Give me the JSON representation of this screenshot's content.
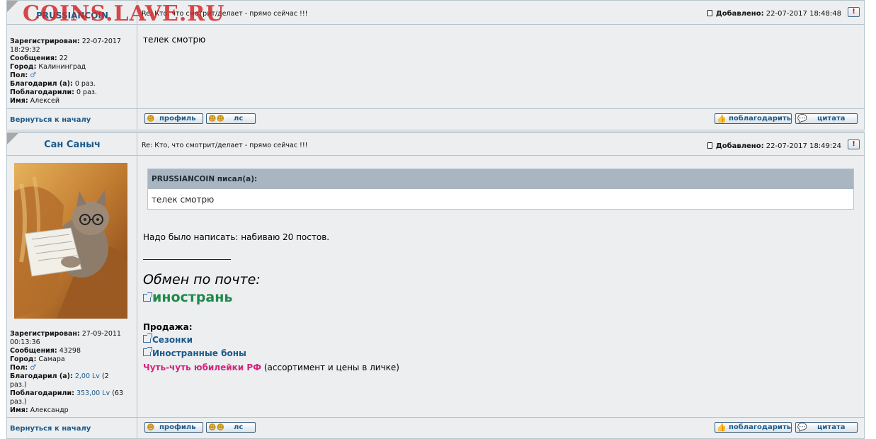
{
  "watermark": "COINS.LAVE.RU",
  "posts": [
    {
      "author": "PRUSSIANCOIN",
      "subject": "Re: Кто, что смотрит/делает - прямо сейчас !!!",
      "added_label": "Добавлено:",
      "added_value": "22-07-2017 18:48:48",
      "report_icon": "!",
      "info": {
        "registered_label": "Зарегистрирован:",
        "registered_value": "22-07-2017",
        "registered_time": "18:29:32",
        "messages_label": "Сообщения:",
        "messages_value": "22",
        "city_label": "Город:",
        "city_value": "Калининград",
        "gender_label": "Пол:",
        "gender_icon": "♂",
        "thanked_label": "Благодарил (а):",
        "thanked_value": "0 раз.",
        "was_thanked_label": "Поблагодарили:",
        "was_thanked_value": "0 раз.",
        "name_label": "Имя:",
        "name_value": "Алексей"
      },
      "body": "телек смотрю"
    },
    {
      "author": "Сан Саныч",
      "subject": "Re: Кто, что смотрит/делает - прямо сейчас !!!",
      "added_label": "Добавлено:",
      "added_value": "22-07-2017 18:49:24",
      "report_icon": "!",
      "info": {
        "registered_label": "Зарегистрирован:",
        "registered_value": "27-09-2011",
        "registered_time": "00:13:36",
        "messages_label": "Сообщения:",
        "messages_value": "43298",
        "city_label": "Город:",
        "city_value": "Самара",
        "gender_label": "Пол:",
        "gender_icon": "♂",
        "thanked_label": "Благодарил (а):",
        "thanked_value": "2,00 Lv",
        "thanked_extra": "(2",
        "thanked_extra2": "раз.)",
        "was_thanked_label": "Поблагодарили:",
        "was_thanked_value": "353,00 Lv",
        "was_thanked_extra": "(63",
        "was_thanked_extra2": "раз.)",
        "name_label": "Имя:",
        "name_value": "Александр"
      },
      "quote_author": "PRUSSIANCOIN писал(а):",
      "quote_body": "телек смотрю",
      "body": "Надо было написать: набиваю 20 постов.",
      "signature": {
        "line": "________________",
        "exchange": "Обмен по почте:",
        "foreign": "инострань",
        "sale": "Продажа:",
        "link1": "Сезонки",
        "link2": "Иностранные боны",
        "jubilee": "Чуть-чуть юбилейки РФ",
        "jubilee_note": " (ассортимент и цены в личке)"
      }
    }
  ],
  "footer": {
    "back_to_top": "Вернуться к началу",
    "profile": "профиль",
    "pm": "лс",
    "thank": "поблагодарить",
    "quote": "цитата"
  }
}
